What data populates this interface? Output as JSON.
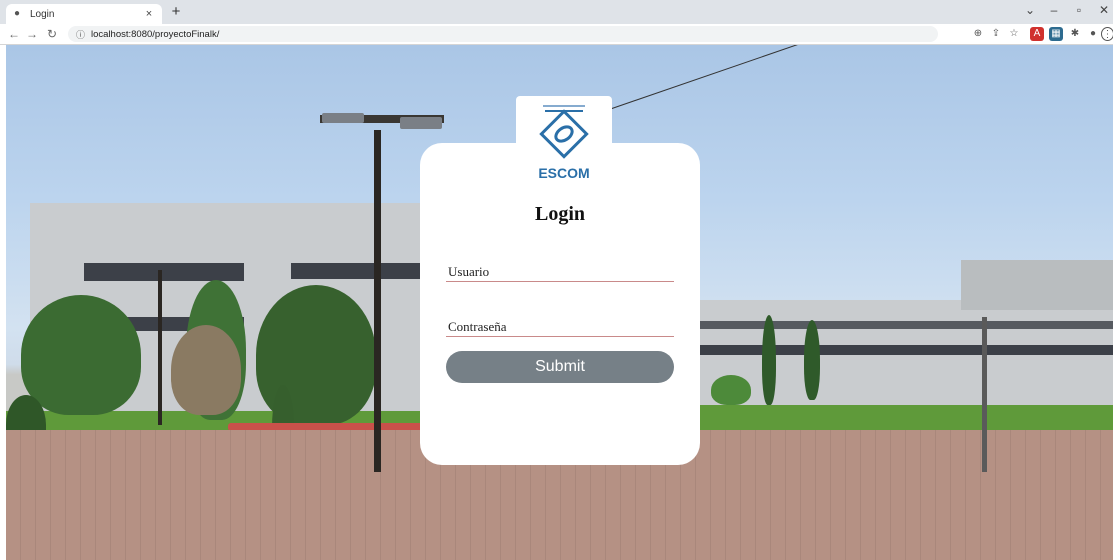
{
  "browser": {
    "tab_title": "Login",
    "tab_close": "×",
    "new_tab": "+",
    "url": "localhost:8080/proyectoFinalk/"
  },
  "login": {
    "logo_text": "ESCOM",
    "title": "Login",
    "username_placeholder": "Usuario",
    "password_placeholder": "Contraseña",
    "submit_label": "Submit"
  },
  "colors": {
    "button": "#768087",
    "field_underline": "#c98a8a",
    "logo_blue": "#2a6fa8"
  }
}
